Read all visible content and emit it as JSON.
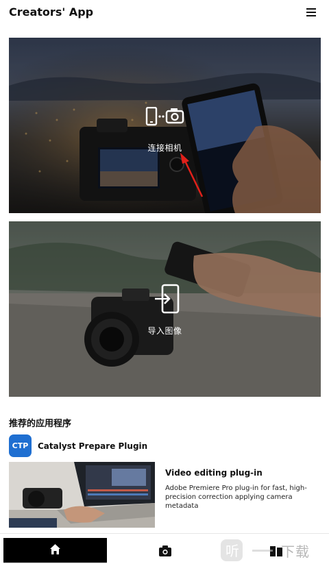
{
  "header": {
    "title": "Creators' App",
    "menu_icon": "hamburger-menu-icon"
  },
  "cards": {
    "connect": {
      "label": "连接相机",
      "icon": "phone-link-camera-icon"
    },
    "import": {
      "label": "导入图像",
      "icon": "import-to-phone-icon"
    }
  },
  "recommended": {
    "section_title": "推荐的应用程序",
    "plugin": {
      "logo_text": "CTP",
      "name": "Catalyst Prepare Plugin",
      "card_title": "Video editing plug-in",
      "card_description": "Adobe Premiere Pro plug-in for fast, high-precision correction applying camera metadata"
    }
  },
  "bottom_nav": {
    "items": [
      {
        "name": "home",
        "icon": "home-icon",
        "active": true
      },
      {
        "name": "camera",
        "icon": "camera-icon",
        "active": false
      },
      {
        "name": "library",
        "icon": "library-icon",
        "active": false
      }
    ]
  },
  "watermark": {
    "text": "下载"
  },
  "colors": {
    "accent": "#1f6fd1",
    "nav_active": "#000000",
    "annotation_arrow": "#e0201a"
  }
}
